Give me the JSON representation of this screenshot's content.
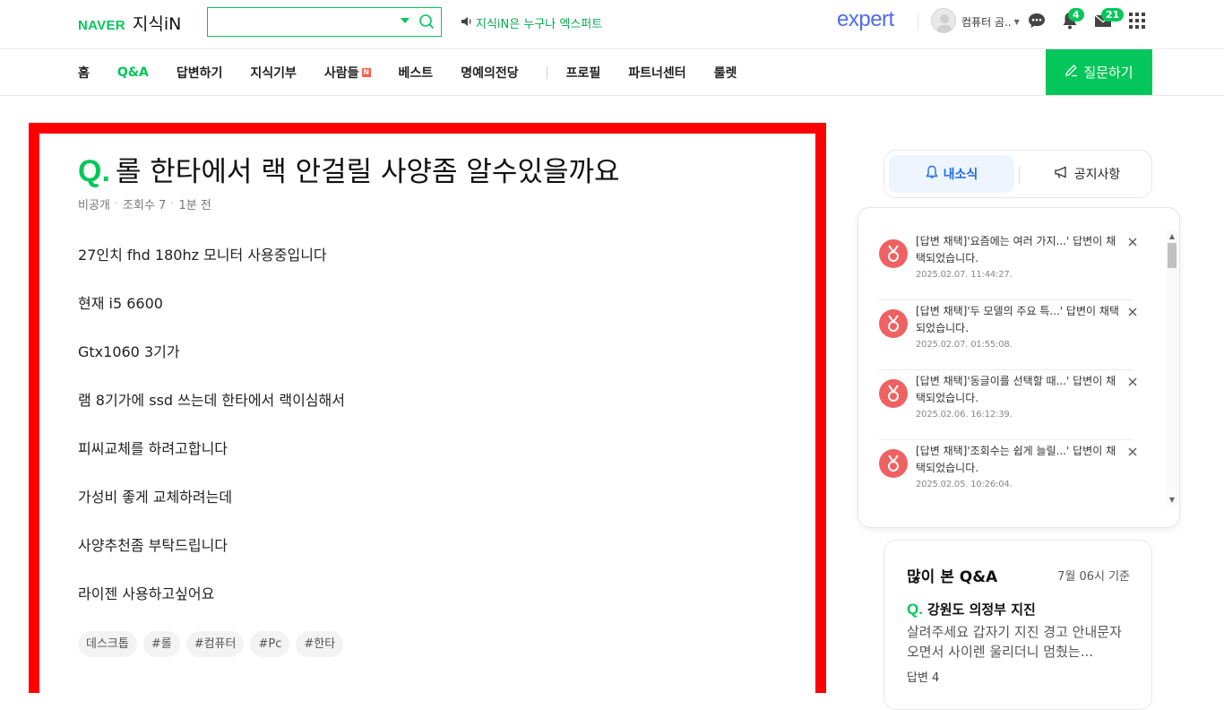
{
  "header": {
    "brand": "NAVER",
    "service": "지식iN",
    "search_value": "",
    "promo_text": "지식iN은 누구나 엑스퍼트",
    "expert_logo": "expert",
    "username": "컴퓨터 곰..",
    "notification_count": "4",
    "mail_count": "21"
  },
  "nav": {
    "items": [
      "홈",
      "Q&A",
      "답변하기",
      "지식기부",
      "사람들",
      "베스트",
      "명예의전당",
      "프로필",
      "파트너센터",
      "룰렛"
    ],
    "active": "Q&A",
    "new_badge": "N",
    "ask_button": "질문하기"
  },
  "question": {
    "q_mark": "Q.",
    "title": "롤 한타에서 랙 안걸릴 사양좀 알수있을까요",
    "meta": {
      "visibility": "비공개",
      "views": "조회수 7",
      "time": "1분 전"
    },
    "body": [
      "27인치 fhd 180hz 모니터 사용중입니다",
      "현재 i5 6600",
      "Gtx1060 3기가",
      "램 8기가에 ssd 쓰는데 한타에서 랙이심해서",
      "피씨교체를 하려고합니다",
      "가성비 좋게 교체하려는데",
      "사양추천좀 부탁드립니다",
      "라이젠 사용하고싶어요"
    ],
    "tags": [
      "데스크톱",
      "#롤",
      "#컴퓨터",
      "#Pc",
      "#한타"
    ]
  },
  "side": {
    "tab_mine": "내소식",
    "tab_notice": "공지사항",
    "notifications": [
      {
        "msg": "[답변 채택]'요즘에는 여러 가지...' 답변이 채택되었습니다.",
        "time": "2025.02.07. 11:44:27."
      },
      {
        "msg": "[답변 채택]'두 모델의 주요 특...' 답변이 채택되었습니다.",
        "time": "2025.02.07. 01:55:08."
      },
      {
        "msg": "[답변 채택]'동글이를 선택할 때...' 답변이 채택되었습니다.",
        "time": "2025.02.06. 16:12:39."
      },
      {
        "msg": "[답변 채택]'조회수는 쉽게 늘릴...' 답변이 채택되었습니다.",
        "time": "2025.02.05. 10:26:04."
      }
    ],
    "popular": {
      "title": "많이 본 Q&A",
      "time": "7월 06시 기준",
      "q_mark": "Q.",
      "q_title": "강원도 의정부 지진",
      "q_body": "살려주세요 갑자기 지진 경고 안내문자 오면서 사이렌 울리더니 멈췄는...",
      "answers": "답변 4"
    }
  },
  "colors": {
    "brand_green": "#03c75a",
    "highlight_red": "#ff0000",
    "expert_blue": "#4f6bf1",
    "tab_blue": "#1f6cf0",
    "notif_red": "#f06161"
  },
  "icons": [
    "dropdown-caret-icon",
    "search-icon",
    "speaker-icon",
    "chat-icon",
    "bell-icon",
    "mail-icon",
    "apps-grid-icon",
    "pencil-icon",
    "megaphone-icon",
    "close-icon",
    "medal-icon"
  ]
}
